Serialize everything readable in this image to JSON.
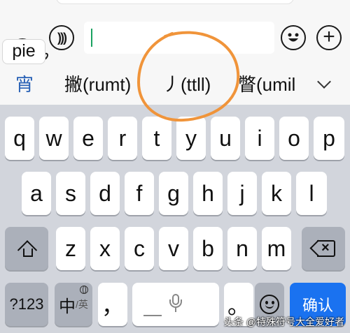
{
  "composition": {
    "text": "pie"
  },
  "input": {
    "value": ""
  },
  "candidates": [
    {
      "text": "宵"
    },
    {
      "text": "撇(rumt)"
    },
    {
      "text": "丿(ttll)"
    },
    {
      "text": "瞥(umil"
    }
  ],
  "keyboard": {
    "row1": [
      "q",
      "w",
      "e",
      "r",
      "t",
      "y",
      "u",
      "i",
      "o",
      "p"
    ],
    "row2": [
      "a",
      "s",
      "d",
      "f",
      "g",
      "h",
      "j",
      "k",
      "l"
    ],
    "row3": [
      "z",
      "x",
      "c",
      "v",
      "b",
      "n",
      "m"
    ],
    "numbers_key": "?123",
    "lang_key_main": "中",
    "lang_key_sub": "/英",
    "comma_key": "，",
    "period_key": "。",
    "confirm_key": "确认"
  },
  "watermark": "头条 @特殊符号大全爱好者",
  "colors": {
    "accent": "#1a72f0",
    "annotation": "#f0943a",
    "caret": "#1aa260",
    "first_candidate": "#2a62b6"
  },
  "icons": [
    "voice-icon",
    "emoji-icon",
    "plus-icon",
    "shift-icon",
    "backspace-icon",
    "globe-icon",
    "microphone-icon",
    "chevron-down-icon"
  ]
}
